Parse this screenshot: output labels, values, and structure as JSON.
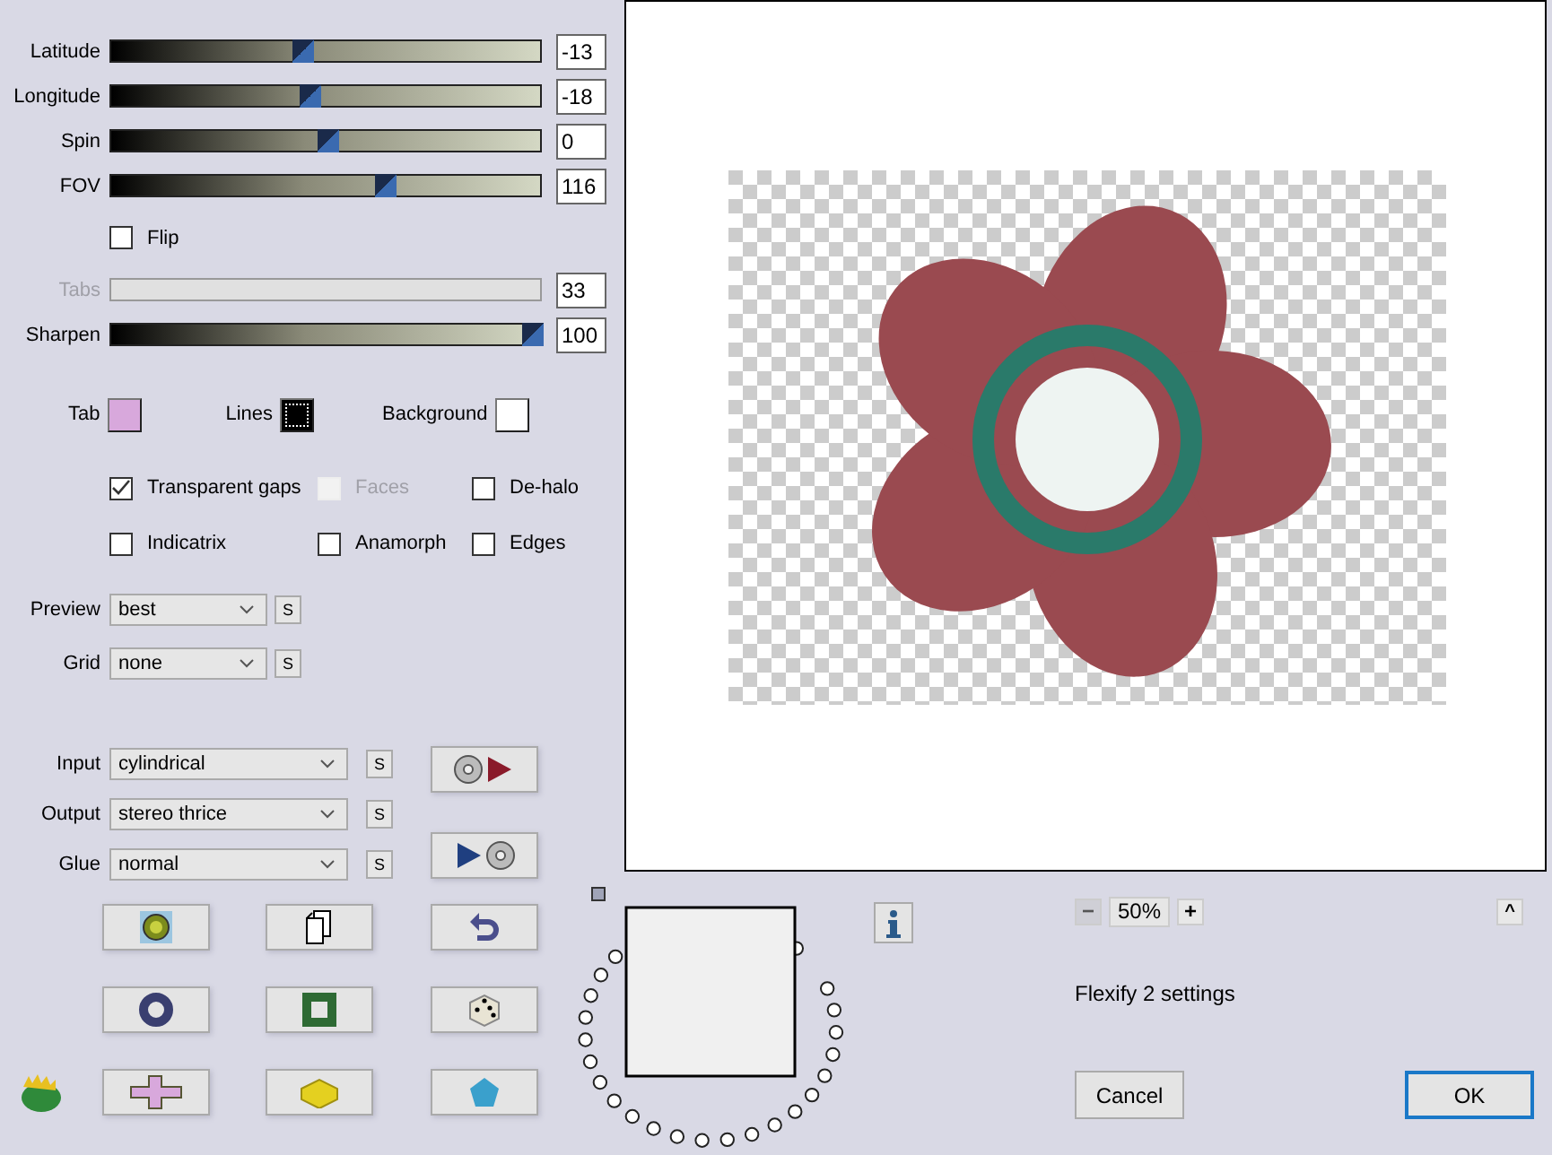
{
  "controls": [
    {
      "kind": "slider",
      "label": "Latitude",
      "level": 0.44,
      "value": "-13",
      "disabled": false
    },
    {
      "kind": "slider",
      "label": "Longitude",
      "level": 0.46,
      "value": "-18",
      "disabled": false
    },
    {
      "kind": "slider",
      "label": "Spin",
      "level": 0.5,
      "value": "0",
      "disabled": false
    },
    {
      "kind": "slider",
      "label": "FOV",
      "level": 0.64,
      "value": "116",
      "disabled": false
    },
    {
      "kind": "checkbox",
      "label": "Flip",
      "checked": false
    },
    {
      "kind": "slider",
      "label": "Tabs",
      "value": "33",
      "disabled": true
    },
    {
      "kind": "slider",
      "label": "Sharpen",
      "level": 1,
      "value": "100",
      "disabled": false
    }
  ],
  "colors": [
    {
      "label": "Tab",
      "color": "#d8a8dc"
    },
    {
      "label": "Lines",
      "color": "#000000"
    },
    {
      "label": "Background",
      "color": "#ffffff"
    }
  ],
  "options": [
    {
      "label": "Transparent gaps",
      "checked": true,
      "disabled": false
    },
    {
      "label": "Faces",
      "checked": false,
      "disabled": true
    },
    {
      "label": "De-halo",
      "checked": false,
      "disabled": false
    },
    {
      "label": "Indicatrix",
      "checked": false,
      "disabled": false
    },
    {
      "label": "Anamorph",
      "checked": false,
      "disabled": false
    },
    {
      "label": "Edges",
      "checked": false,
      "disabled": false
    }
  ],
  "view_dropdowns": [
    {
      "label": "Preview",
      "value": "best",
      "side_button": "S"
    },
    {
      "label": "Grid",
      "value": "none",
      "side_button": "S"
    }
  ],
  "mapping_dropdowns": [
    {
      "label": "Input",
      "value": "cylindrical",
      "side_button": "S"
    },
    {
      "label": "Output",
      "value": "stereo thrice",
      "side_button": "S"
    },
    {
      "label": "Glue",
      "value": "normal",
      "side_button": "S"
    }
  ],
  "zoom": {
    "minus": "−",
    "value": "50%",
    "plus": "+"
  },
  "collapse": "^",
  "caption": "Flexify 2 settings",
  "buttons": [
    {
      "label": "Cancel",
      "default": false
    },
    {
      "label": "OK",
      "default": true
    }
  ]
}
